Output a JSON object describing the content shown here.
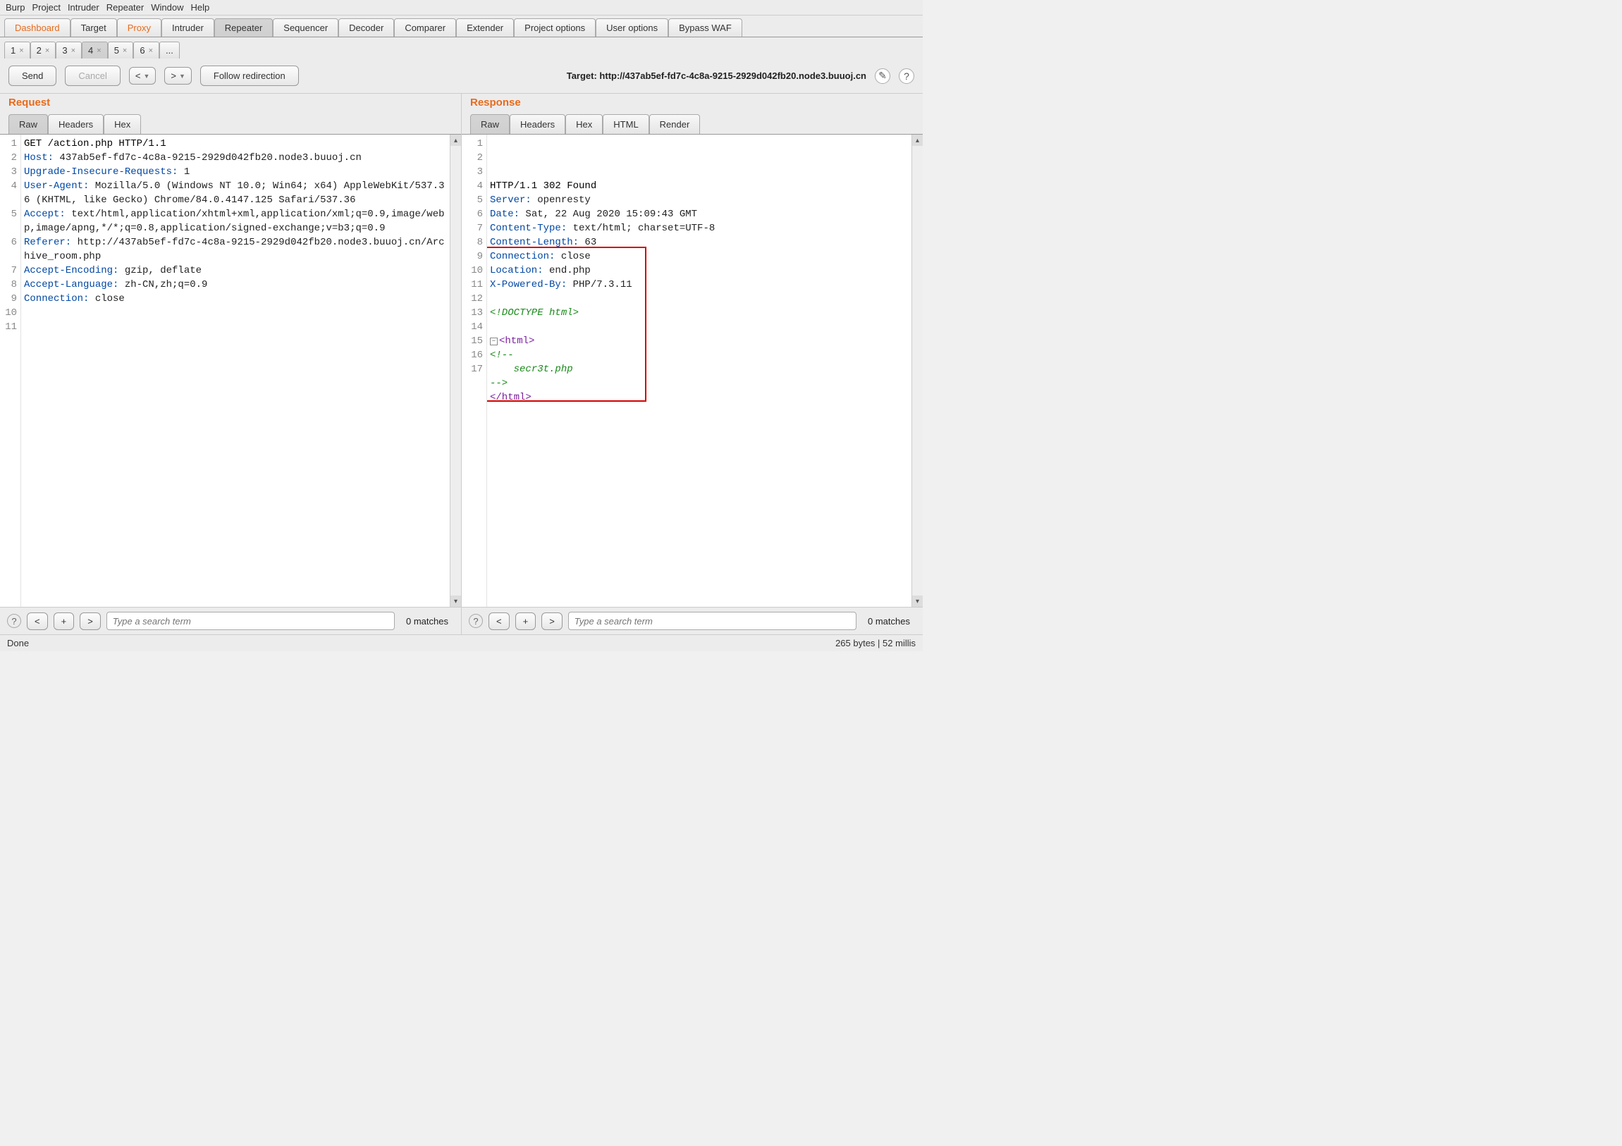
{
  "menu": [
    "Burp",
    "Project",
    "Intruder",
    "Repeater",
    "Window",
    "Help"
  ],
  "main_tabs": [
    {
      "label": "Dashboard",
      "orange": true
    },
    {
      "label": "Target"
    },
    {
      "label": "Proxy",
      "orange": true
    },
    {
      "label": "Intruder"
    },
    {
      "label": "Repeater",
      "active": true
    },
    {
      "label": "Sequencer"
    },
    {
      "label": "Decoder"
    },
    {
      "label": "Comparer"
    },
    {
      "label": "Extender"
    },
    {
      "label": "Project options"
    },
    {
      "label": "User options"
    },
    {
      "label": "Bypass WAF"
    }
  ],
  "sub_tabs": [
    {
      "n": "1"
    },
    {
      "n": "2"
    },
    {
      "n": "3"
    },
    {
      "n": "4",
      "active": true
    },
    {
      "n": "5"
    },
    {
      "n": "6"
    },
    {
      "n": "...",
      "ellipsis": true
    }
  ],
  "buttons": {
    "send": "Send",
    "cancel": "Cancel",
    "follow": "Follow redirection"
  },
  "target_label": "Target: http://437ab5ef-fd7c-4c8a-9215-2929d042fb20.node3.buuoj.cn",
  "request": {
    "title": "Request",
    "tabs": [
      "Raw",
      "Headers",
      "Hex"
    ],
    "lines": [
      {
        "n": "1",
        "parts": [
          {
            "c": "first",
            "t": "GET /action.php HTTP/1.1"
          }
        ]
      },
      {
        "n": "2",
        "parts": [
          {
            "c": "hdr",
            "t": "Host:"
          },
          {
            "c": "txt",
            "t": " 437ab5ef-fd7c-4c8a-9215-2929d042fb20.node3.buuoj.cn"
          }
        ]
      },
      {
        "n": "3",
        "parts": [
          {
            "c": "hdr",
            "t": "Upgrade-Insecure-Requests:"
          },
          {
            "c": "txt",
            "t": " 1"
          }
        ]
      },
      {
        "n": "4",
        "parts": [
          {
            "c": "hdr",
            "t": "User-Agent:"
          },
          {
            "c": "txt",
            "t": " Mozilla/5.0 (Windows NT 10.0; Win64; x64) AppleWebKit/537.36 (KHTML, like Gecko) Chrome/84.0.4147.125 Safari/537.36"
          }
        ]
      },
      {
        "n": "5",
        "parts": [
          {
            "c": "hdr",
            "t": "Accept:"
          },
          {
            "c": "txt",
            "t": " text/html,application/xhtml+xml,application/xml;q=0.9,image/webp,image/apng,*/*;q=0.8,application/signed-exchange;v=b3;q=0.9"
          }
        ]
      },
      {
        "n": "6",
        "parts": [
          {
            "c": "hdr",
            "t": "Referer:"
          },
          {
            "c": "txt",
            "t": " http://437ab5ef-fd7c-4c8a-9215-2929d042fb20.node3.buuoj.cn/Archive_room.php"
          }
        ]
      },
      {
        "n": "7",
        "parts": [
          {
            "c": "hdr",
            "t": "Accept-Encoding:"
          },
          {
            "c": "txt",
            "t": " gzip, deflate"
          }
        ]
      },
      {
        "n": "8",
        "parts": [
          {
            "c": "hdr",
            "t": "Accept-Language:"
          },
          {
            "c": "txt",
            "t": " zh-CN,zh;q=0.9"
          }
        ]
      },
      {
        "n": "9",
        "parts": [
          {
            "c": "hdr",
            "t": "Connection:"
          },
          {
            "c": "txt",
            "t": " close"
          }
        ]
      },
      {
        "n": "10",
        "parts": []
      },
      {
        "n": "11",
        "parts": []
      }
    ],
    "search_placeholder": "Type a search term",
    "matches": "0 matches"
  },
  "response": {
    "title": "Response",
    "tabs": [
      "Raw",
      "Headers",
      "Hex",
      "HTML",
      "Render"
    ],
    "lines": [
      {
        "n": "1",
        "parts": [
          {
            "c": "first",
            "t": "HTTP/1.1 302 Found"
          }
        ]
      },
      {
        "n": "2",
        "parts": [
          {
            "c": "hdr",
            "t": "Server:"
          },
          {
            "c": "txt",
            "t": " openresty"
          }
        ]
      },
      {
        "n": "3",
        "parts": [
          {
            "c": "hdr",
            "t": "Date:"
          },
          {
            "c": "txt",
            "t": " Sat, 22 Aug 2020 15:09:43 GMT"
          }
        ]
      },
      {
        "n": "4",
        "parts": [
          {
            "c": "hdr",
            "t": "Content-Type:"
          },
          {
            "c": "txt",
            "t": " text/html; charset=UTF-8"
          }
        ]
      },
      {
        "n": "5",
        "parts": [
          {
            "c": "hdr",
            "t": "Content-Length:"
          },
          {
            "c": "txt",
            "t": " 63"
          }
        ]
      },
      {
        "n": "6",
        "parts": [
          {
            "c": "hdr",
            "t": "Connection:"
          },
          {
            "c": "txt",
            "t": " close"
          }
        ]
      },
      {
        "n": "7",
        "parts": [
          {
            "c": "hdr",
            "t": "Location:"
          },
          {
            "c": "txt",
            "t": " end.php"
          }
        ]
      },
      {
        "n": "8",
        "parts": [
          {
            "c": "hdr",
            "t": "X-Powered-By:"
          },
          {
            "c": "txt",
            "t": " PHP/7.3.11"
          }
        ]
      },
      {
        "n": "9",
        "parts": []
      },
      {
        "n": "10",
        "parts": [
          {
            "c": "cmt",
            "t": "<!DOCTYPE html>"
          }
        ]
      },
      {
        "n": "11",
        "parts": []
      },
      {
        "n": "12",
        "fold": true,
        "parts": [
          {
            "c": "tag",
            "t": "<html>"
          }
        ]
      },
      {
        "n": "13",
        "parts": [
          {
            "c": "cmt",
            "t": "<!--"
          }
        ]
      },
      {
        "n": "14",
        "parts": [
          {
            "c": "cmt",
            "t": "    secr3t.php"
          }
        ]
      },
      {
        "n": "15",
        "parts": [
          {
            "c": "cmt",
            "t": "-->"
          }
        ]
      },
      {
        "n": "16",
        "parts": [
          {
            "c": "tag",
            "t": "</html>"
          }
        ]
      },
      {
        "n": "17",
        "parts": []
      }
    ],
    "search_placeholder": "Type a search term",
    "matches": "0 matches"
  },
  "status_left": "Done",
  "status_right": "265 bytes | 52 millis"
}
